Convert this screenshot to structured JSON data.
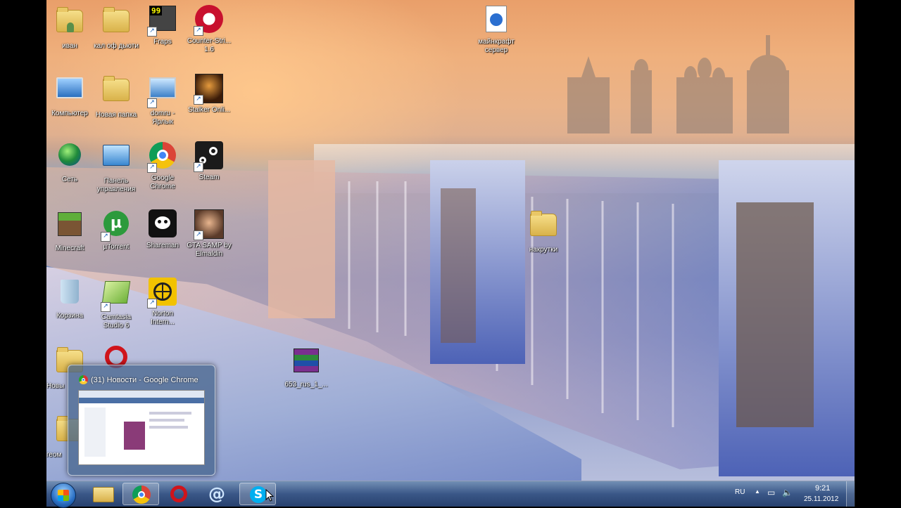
{
  "desktop": {
    "icons": [
      {
        "label": "иван"
      },
      {
        "label": "кал оф дьюти"
      },
      {
        "label": "Fraps"
      },
      {
        "label": "Counter-Stri... 1.6"
      },
      {
        "label": "Компьютер"
      },
      {
        "label": "Новая папка"
      },
      {
        "label": "domru - Ярлык"
      },
      {
        "label": "Stalker Onli..."
      },
      {
        "label": "Сеть"
      },
      {
        "label": "Панель управления"
      },
      {
        "label": "Google Chrome"
      },
      {
        "label": "Steam"
      },
      {
        "label": "Minecraft"
      },
      {
        "label": "µTorrent"
      },
      {
        "label": "Shareman"
      },
      {
        "label": "GTA SAMP by Elmaldin"
      },
      {
        "label": "Корзина"
      },
      {
        "label": "Camtasia Studio 6"
      },
      {
        "label": "Norton Intern..."
      },
      {
        "label": "Новы"
      },
      {
        "label": "геом"
      },
      {
        "label": "майнкрафт сервер"
      },
      {
        "label": "накрутки"
      },
      {
        "label": "653_rus_1_..."
      }
    ],
    "fraps_badge": "99"
  },
  "thumbnail": {
    "title": "(31) Новости - Google Chrome"
  },
  "taskbar": {
    "apps": [
      "explorer",
      "chrome",
      "opera",
      "mail",
      "skype"
    ],
    "language": "RU",
    "time": "9:21",
    "date": "25.11.2012"
  }
}
